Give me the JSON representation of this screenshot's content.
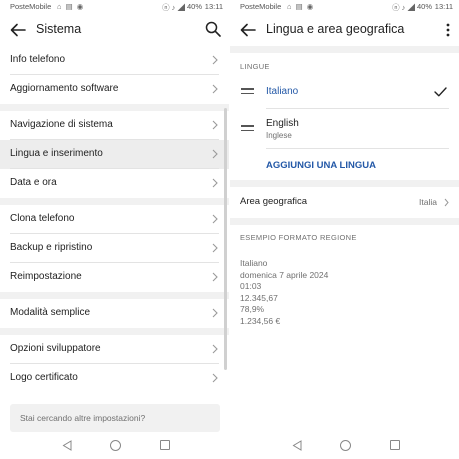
{
  "status_bar": {
    "carrier": "PosteMobile",
    "battery": "40%",
    "time": "13:11"
  },
  "left": {
    "title": "Sistema",
    "groups": [
      [
        "Info telefono",
        "Aggiornamento software"
      ],
      [
        "Navigazione di sistema",
        "Lingua e inserimento",
        "Data e ora"
      ],
      [
        "Clona telefono",
        "Backup e ripristino",
        "Reimpostazione"
      ],
      [
        "Modalità semplice"
      ],
      [
        "Opzioni sviluppatore",
        "Logo certificato"
      ]
    ],
    "highlighted": "Lingua e inserimento",
    "search_prompt": "Stai cercando altre impostazioni?"
  },
  "right": {
    "title": "Lingua e area geografica",
    "languages_header": "LINGUE",
    "languages": [
      {
        "name": "Italiano",
        "subtitle": "",
        "selected": true
      },
      {
        "name": "English",
        "subtitle": "Inglese",
        "selected": false
      }
    ],
    "add_language": "AGGIUNGI UNA LINGUA",
    "area_label": "Area geografica",
    "area_value": "Italia",
    "example_header": "ESEMPIO FORMATO REGIONE",
    "example_lines": [
      "Italiano",
      "domenica 7 aprile 2024",
      "01:03",
      "12.345,67",
      "78,9%",
      "1.234,56 €"
    ]
  },
  "colors": {
    "accent": "#2358a7",
    "section_gap": "#f1f1f1",
    "highlight": "#ededed"
  },
  "icons": [
    "back-arrow-icon",
    "search-icon",
    "more-vert-icon",
    "chevron-right-icon",
    "drag-handle-icon",
    "check-icon",
    "nav-back-icon",
    "nav-home-icon",
    "nav-recents-icon"
  ]
}
